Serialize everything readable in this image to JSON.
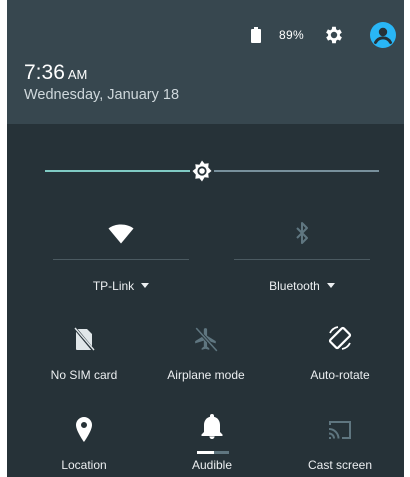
{
  "status": {
    "battery_percent": "89%",
    "battery_level": 0.89,
    "settings_icon": "gear-icon",
    "user_icon": "account-circle-icon"
  },
  "header": {
    "time": "7:36",
    "ampm": "AM",
    "date": "Wednesday, January 18"
  },
  "brightness": {
    "level": 0.47,
    "icon": "brightness-icon"
  },
  "tiles_primary": [
    {
      "id": "wifi",
      "icon": "wifi-icon",
      "label": "TP-Link",
      "active": true
    },
    {
      "id": "bluetooth",
      "icon": "bluetooth-icon",
      "label": "Bluetooth",
      "active": false
    }
  ],
  "tiles": [
    {
      "id": "sim",
      "icon": "no-sim-icon",
      "label": "No SIM card",
      "active": true
    },
    {
      "id": "airplane",
      "icon": "airplane-icon",
      "label": "Airplane mode",
      "active": false
    },
    {
      "id": "rotate",
      "icon": "auto-rotate-icon",
      "label": "Auto-rotate",
      "active": true
    },
    {
      "id": "location",
      "icon": "location-pin-icon",
      "label": "Location",
      "active": true
    },
    {
      "id": "audible",
      "icon": "bell-icon",
      "label": "Audible",
      "active": true
    },
    {
      "id": "cast",
      "icon": "cast-icon",
      "label": "Cast screen",
      "active": false
    }
  ],
  "colors": {
    "panel_bg": "#263238",
    "header_bg": "#37474f",
    "accent": "#80cbc4",
    "inactive_icon": "#5f7680"
  }
}
